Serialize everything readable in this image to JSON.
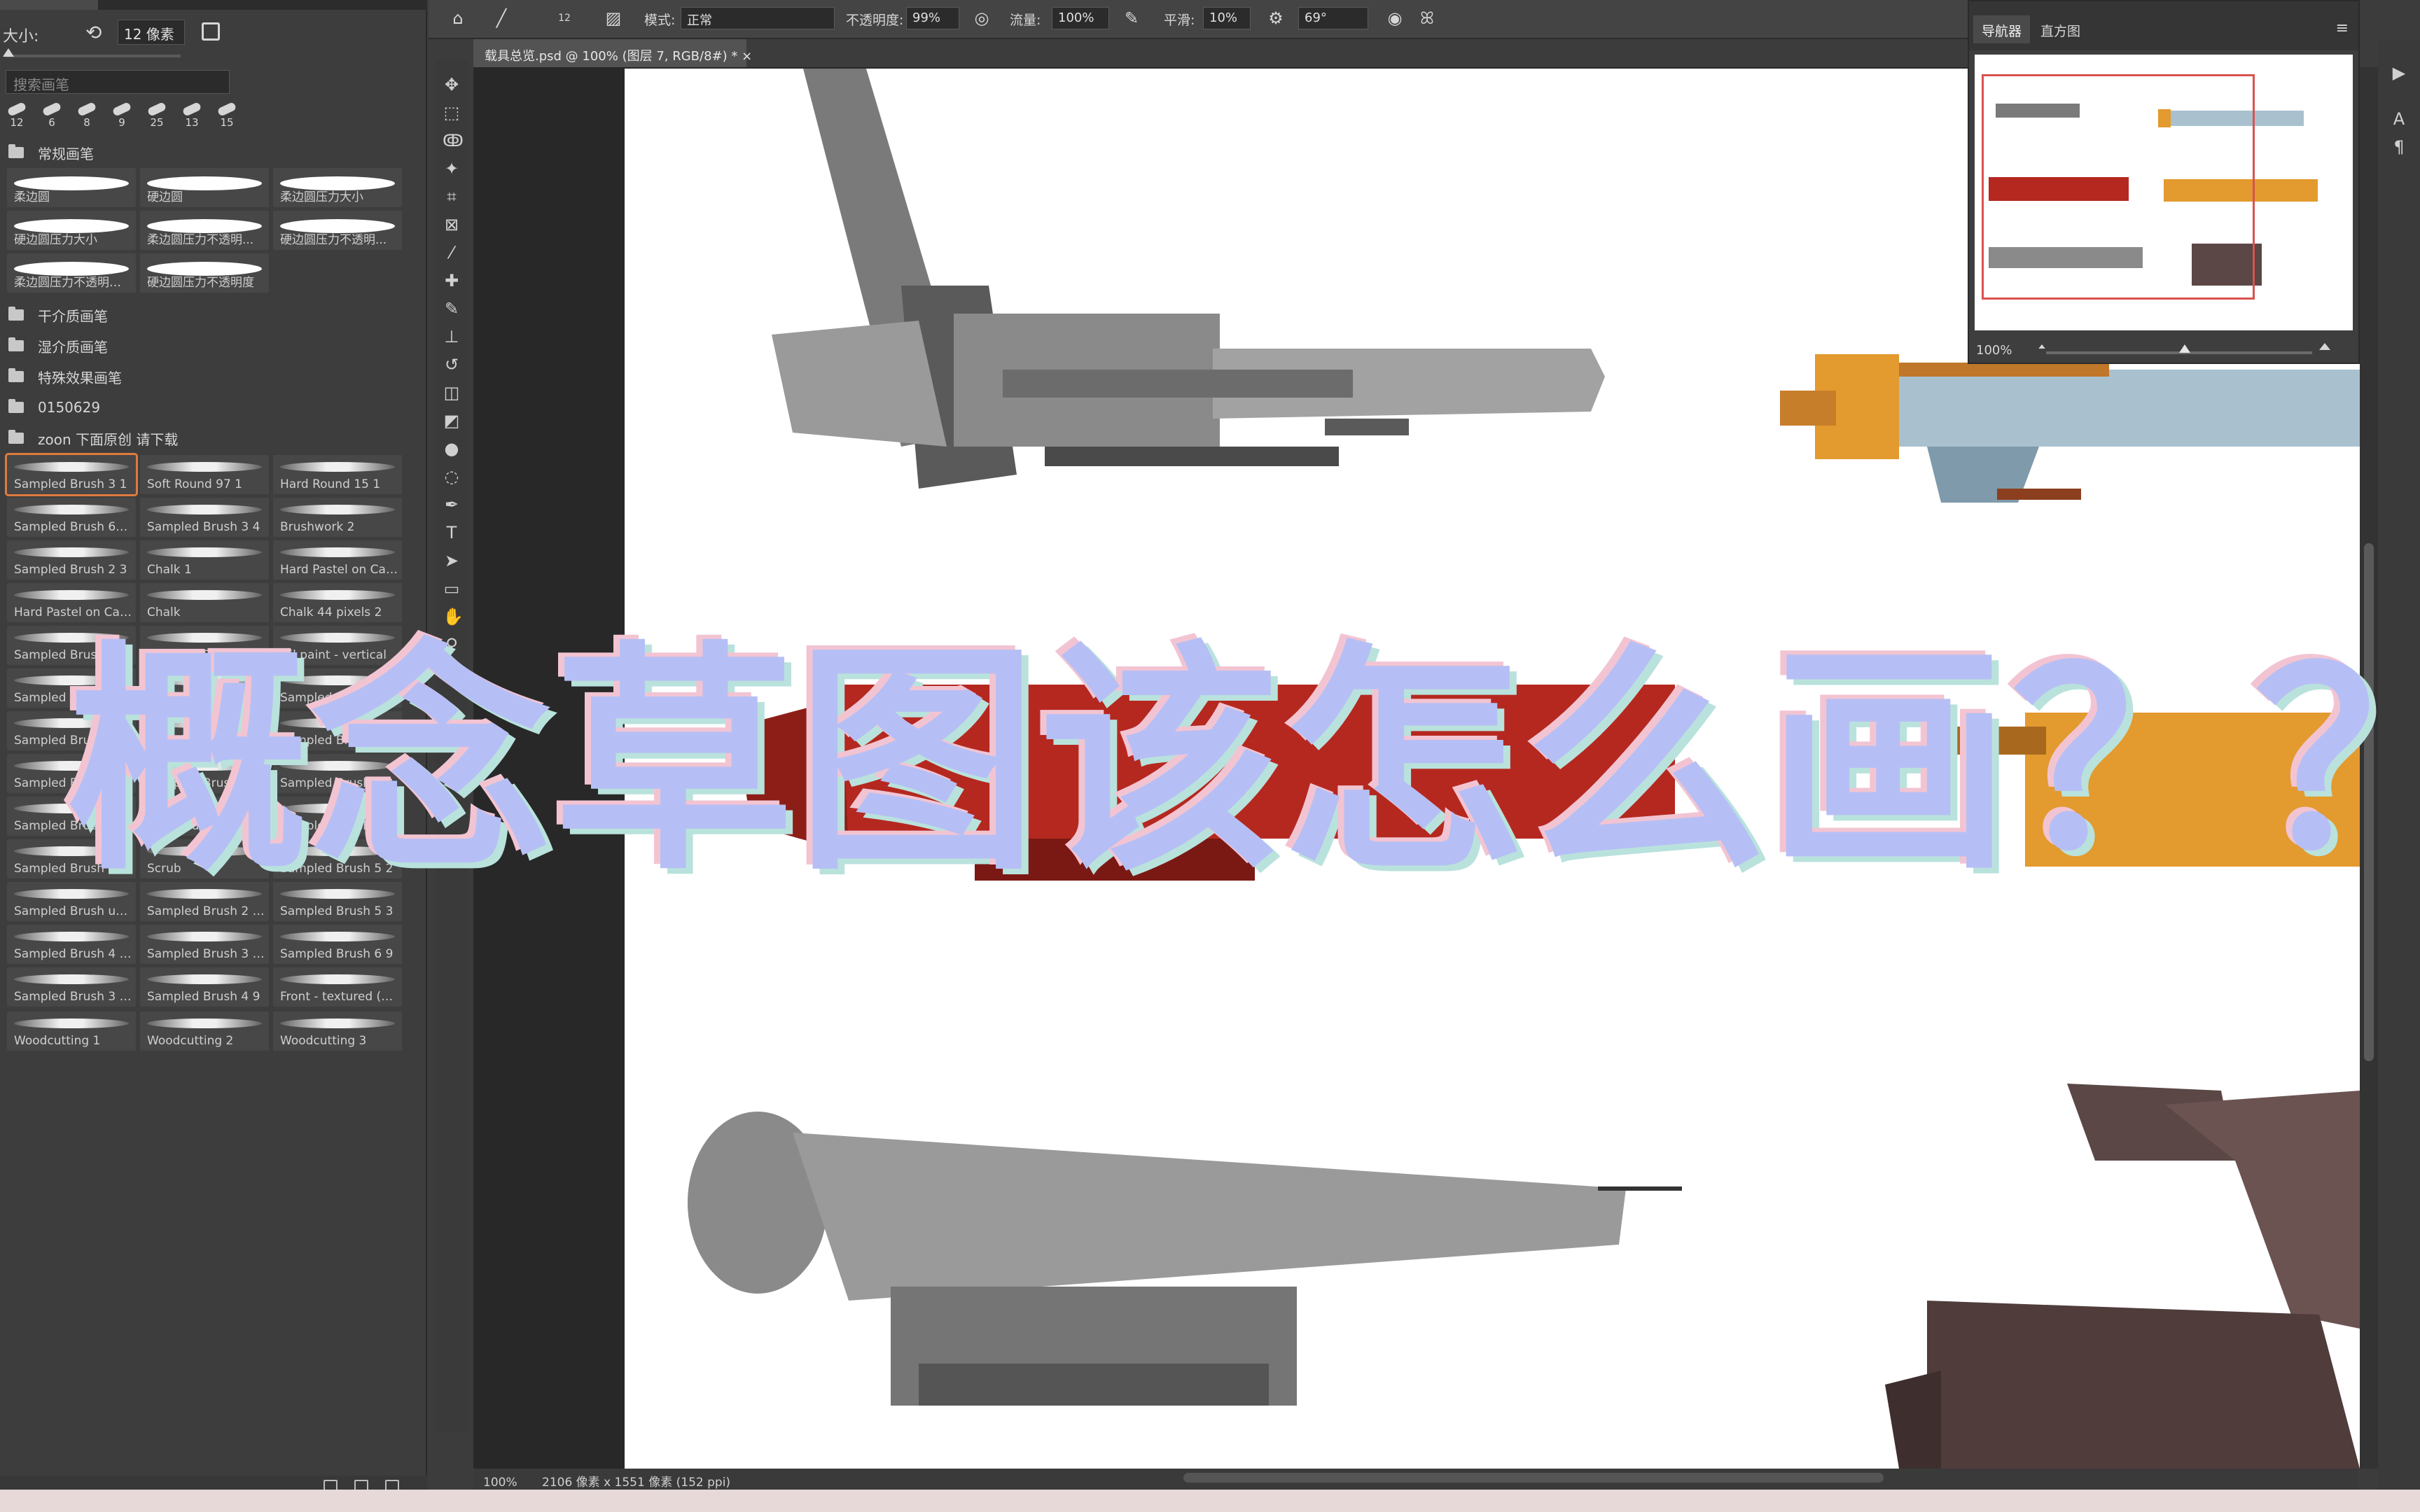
{
  "brush_panel": {
    "size_label": "大小:",
    "size_value": "12 像素",
    "search_placeholder": "搜索画笔",
    "recent_sizes": [
      "12",
      "6",
      "8",
      "9",
      "25",
      "13",
      "15"
    ],
    "folders": [
      {
        "name": "常规画笔",
        "expanded": true
      },
      {
        "name": "干介质画笔",
        "expanded": false
      },
      {
        "name": "湿介质画笔",
        "expanded": false
      },
      {
        "name": "特殊效果画笔",
        "expanded": false
      },
      {
        "name": "0150629",
        "expanded": false
      },
      {
        "name": "zoon 下面原创 请下载",
        "expanded": true
      }
    ],
    "general_brushes": [
      "柔边圆",
      "硬边圆",
      "柔边圆压力大小",
      "硬边圆压力大小",
      "柔边圆压力不透明...",
      "硬边圆压力不透明...",
      "柔边圆压力不透明度...",
      "硬边圆压力不透明度"
    ],
    "custom_brushes": [
      "Sampled Brush 3 1",
      "Soft Round 97 1",
      "Hard Round 15 1",
      "Sampled Brush 63 1",
      "Sampled Brush 3 4",
      "Brushwork 2",
      "Sampled Brush 2 3",
      "Chalk 1",
      "Hard Pastel on Canv",
      "Hard Pastel on Canv",
      "Chalk",
      "Chalk 44 pixels 2",
      "Sampled Brush 2 6",
      "Sampled Brush 3 2",
      "Oil paint - vertical",
      "Sampled Brush 4 1",
      "Sampled Brush 5 1",
      "Sampled Brush 6 1",
      "Sampled Brush 7 1",
      "Sampled Brush 8 1",
      "Sampled Brush 9 1",
      "Sampled Brush 10",
      "Sampled Brush 2 8",
      "Sampled Brush 3 8",
      "Sampled Brush 11",
      "Sampled Brush 12",
      "Sampled Brush 3 3",
      "Sampled Brush 2 9",
      "Scrub",
      "Sampled Brush 5 2",
      "Sampled Brush untextured",
      "Sampled Brush 2 11",
      "Sampled Brush 5 3",
      "Sampled Brush 4 11",
      "Sampled Brush 3 15",
      "Sampled Brush 6 9",
      "Sampled Brush 3 12",
      "Sampled Brush 4 9",
      "Front - textured (ba..."
    ],
    "woodcutting": [
      "Woodcutting 1",
      "Woodcutting 2",
      "Woodcutting 3"
    ]
  },
  "options_bar": {
    "brush_size": "12",
    "mode_label": "模式:",
    "mode_value": "正常",
    "opacity_label": "不透明度:",
    "opacity_value": "99%",
    "flow_label": "流量:",
    "flow_value": "100%",
    "smooth_label": "平滑:",
    "smooth_value": "10%",
    "angle_value": "69°"
  },
  "document": {
    "tab_title": "载具总览.psd @ 100% (图层 7, RGB/8#) *",
    "status_zoom": "100%",
    "status_info": "2106 像素 x 1551 像素 (152 ppi)"
  },
  "navigator": {
    "tab_navigator": "导航器",
    "tab_histogram": "直方图",
    "zoom": "100%"
  },
  "overlay": {
    "title": "概念草图该怎么画？？"
  },
  "colors": {
    "overlay_fill": "#b6bff5",
    "overlay_pink": "#f2c4d2",
    "overlay_mint": "#b9e2dc",
    "selection": "#e07a3e",
    "nav_view": "#d9534f",
    "ship_gray": "#6f6f6f",
    "ship_red": "#b5281f",
    "ship_orange": "#e39a2e",
    "ship_blue": "#a9c1cf",
    "ship_brown": "#5b4746"
  }
}
